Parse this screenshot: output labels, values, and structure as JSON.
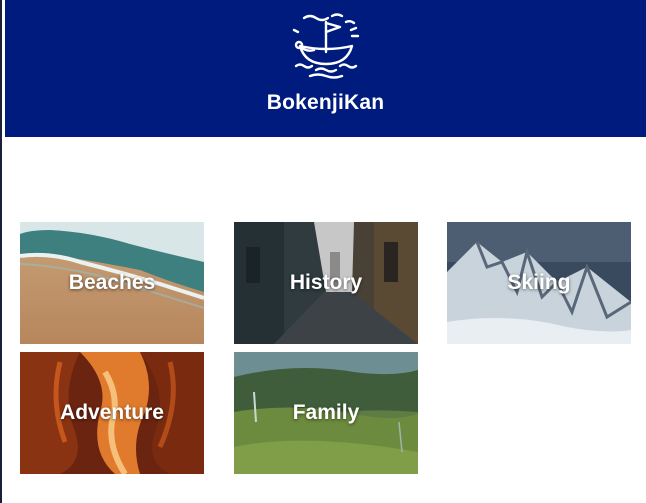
{
  "header": {
    "brand": "BokenjiKan",
    "logo_icon": "boat-flag-logo-icon",
    "background_color": "#001b7e"
  },
  "categories": [
    {
      "label": "Beaches",
      "image": "beach-waves-image"
    },
    {
      "label": "History",
      "image": "old-street-image"
    },
    {
      "label": "Skiing",
      "image": "snowy-mountain-image"
    },
    {
      "label": "Adventure",
      "image": "canyon-image"
    },
    {
      "label": "Family",
      "image": "green-valley-image"
    }
  ]
}
